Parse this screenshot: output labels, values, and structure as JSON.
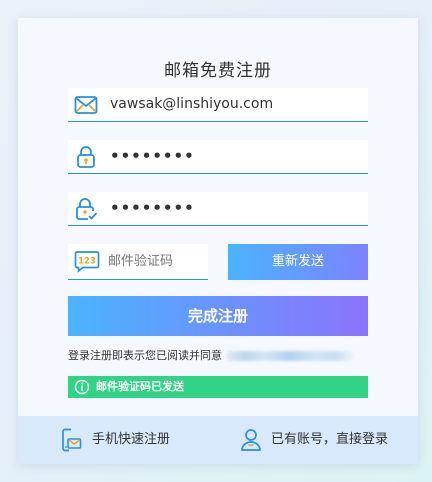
{
  "form": {
    "title": "邮箱免费注册",
    "email": {
      "value": "vawsak@linshiyou.com",
      "icon": "mail-icon"
    },
    "password": {
      "value": "••••••••",
      "icon": "lock-icon"
    },
    "confirm_password": {
      "value": "••••••••",
      "icon": "lock-check-icon"
    },
    "code": {
      "placeholder": "邮件验证码",
      "icon": "code-123-icon"
    },
    "resend_label": "重新发送",
    "submit_label": "完成注册",
    "agreement_text": "登录注册即表示您已阅读并同意",
    "notice_text": "邮件验证码已发送"
  },
  "footer": {
    "phone_register_label": "手机快速注册",
    "login_label": "已有账号，直接登录"
  },
  "colors": {
    "accent": "#2a9abd",
    "button_gradient_start": "#4ab4ff",
    "button_gradient_end": "#8a73fb",
    "success": "#31d487",
    "footer_bg": "#d8e9fb"
  }
}
